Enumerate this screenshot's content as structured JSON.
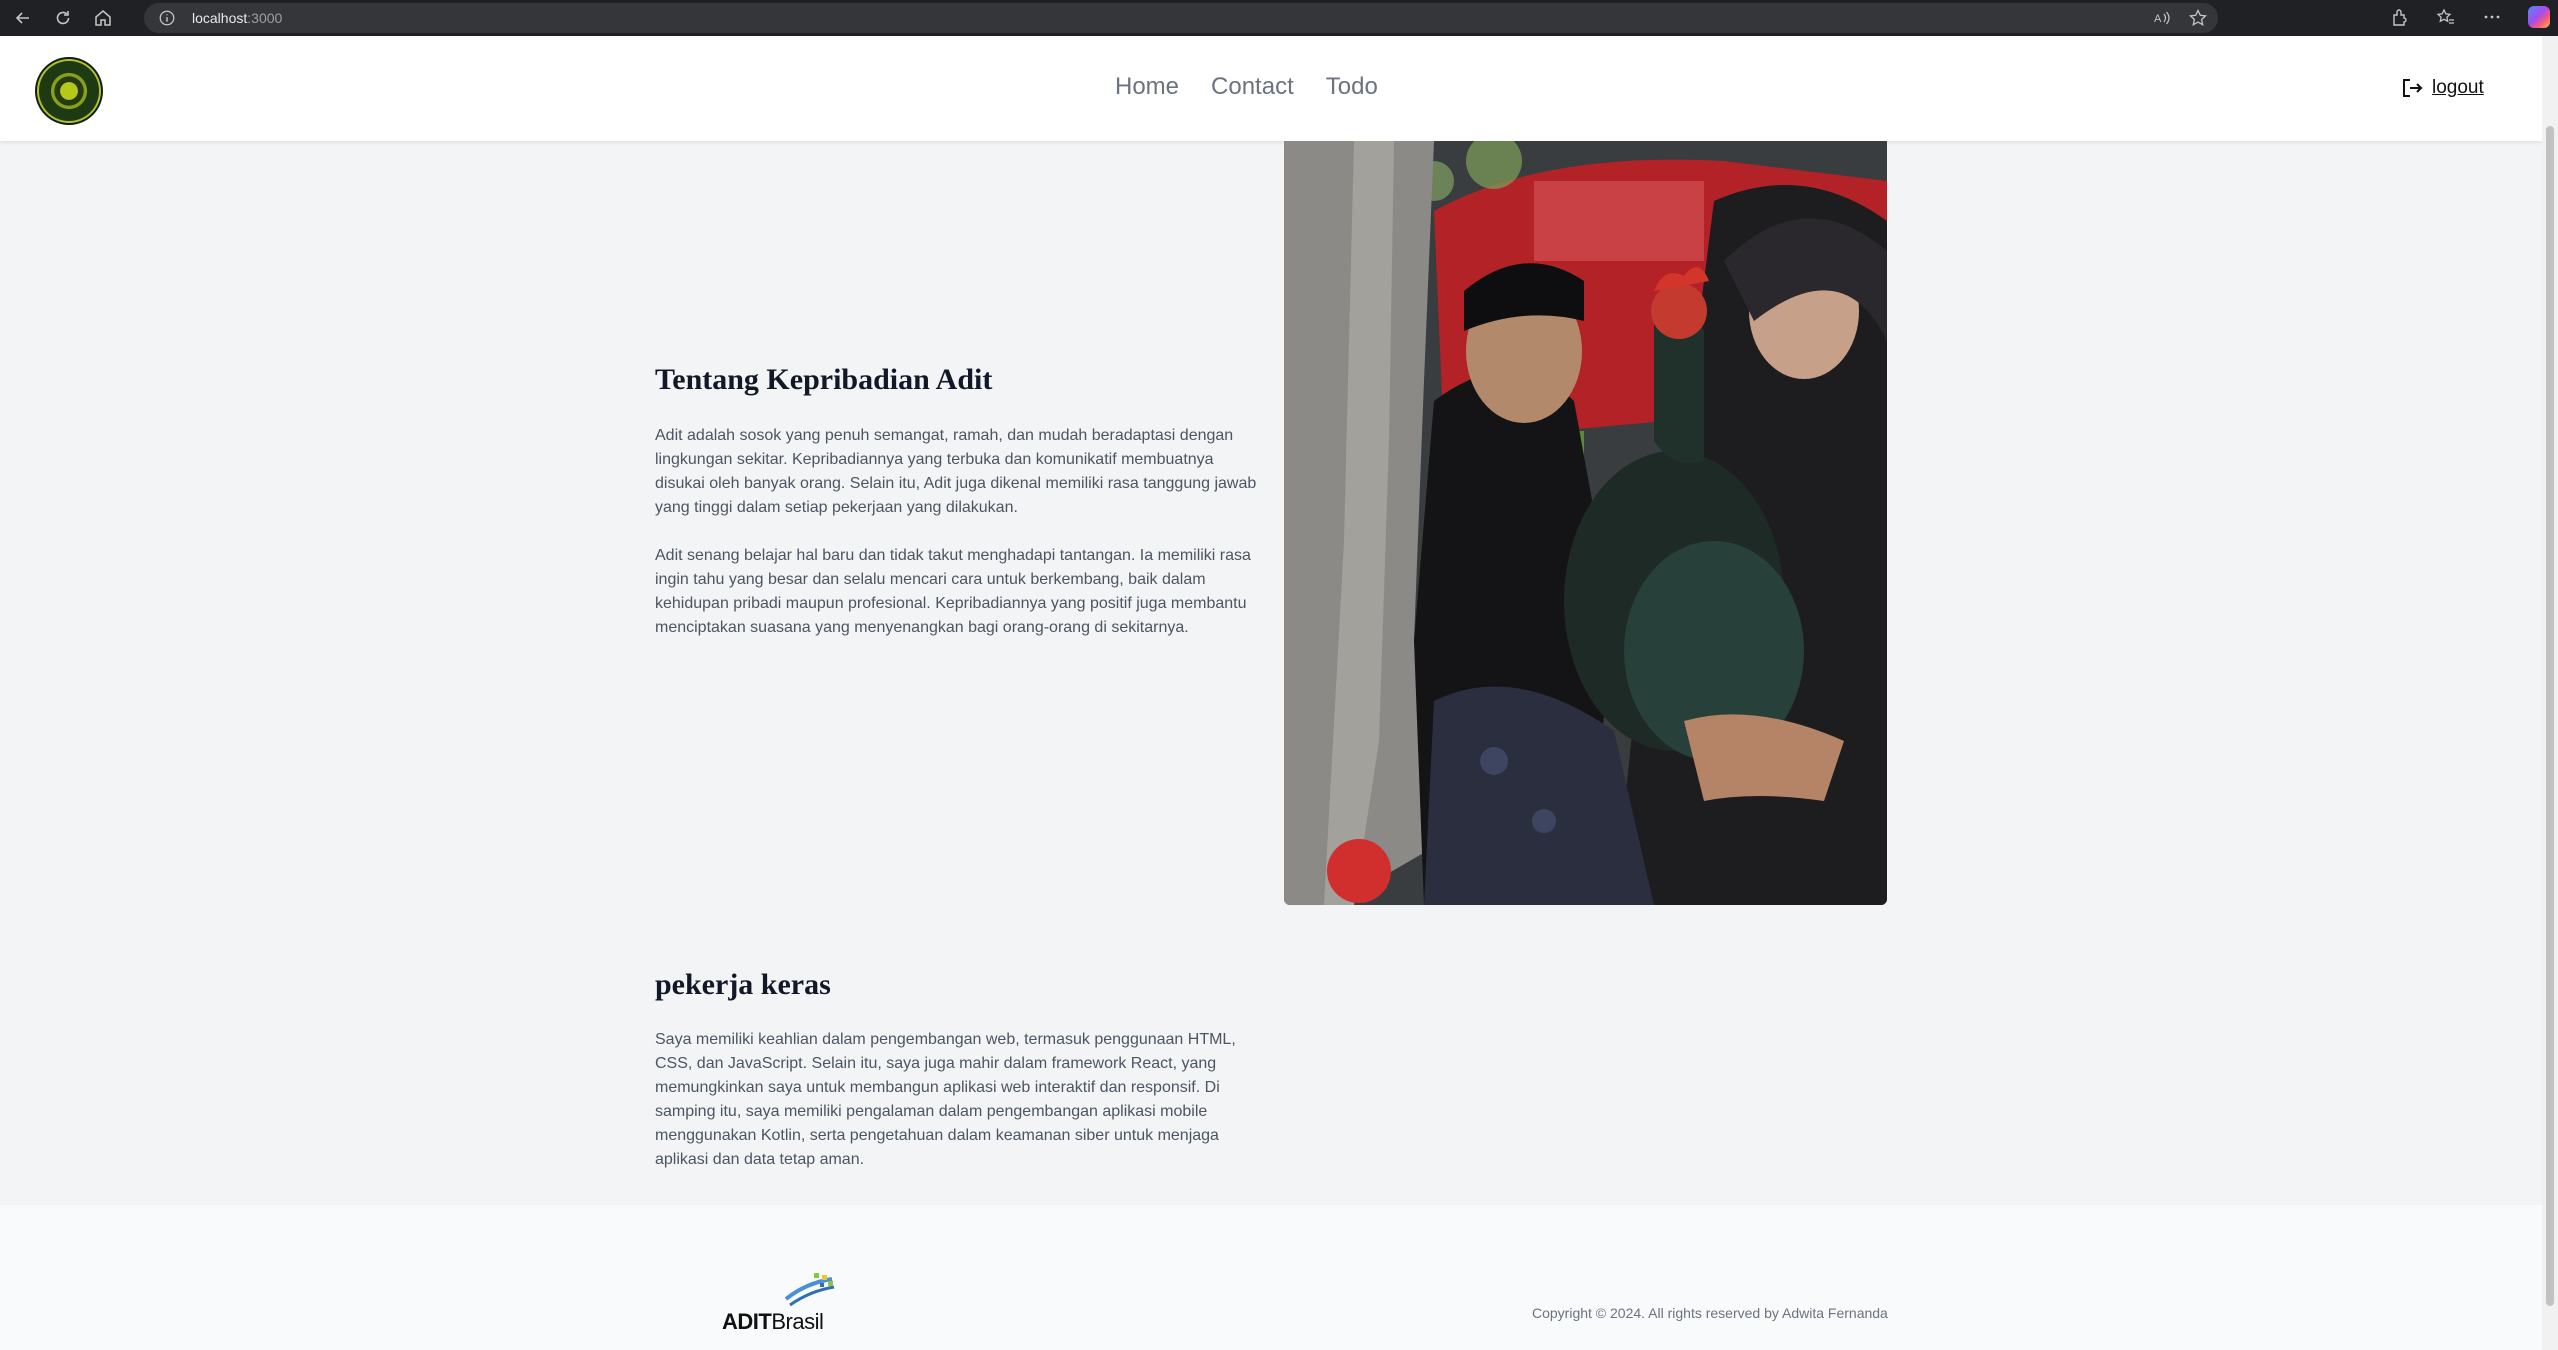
{
  "browser": {
    "url_host": "localhost",
    "url_port": ":3000"
  },
  "nav": {
    "items": [
      {
        "label": "Home"
      },
      {
        "label": "Contact"
      },
      {
        "label": "Todo"
      }
    ],
    "logout_label": "logout"
  },
  "about": {
    "title": "Tentang Kepribadian Adit",
    "paragraphs": [
      "Adit adalah sosok yang penuh semangat, ramah, dan mudah beradaptasi dengan lingkungan sekitar. Kepribadiannya yang terbuka dan komunikatif membuatnya disukai oleh banyak orang. Selain itu, Adit juga dikenal memiliki rasa tanggung jawab yang tinggi dalam setiap pekerjaan yang dilakukan.",
      "Adit senang belajar hal baru dan tidak takut menghadapi tantangan. Ia memiliki rasa ingin tahu yang besar dan selalu mencari cara untuk berkembang, baik dalam kehidupan pribadi maupun profesional. Kepribadiannya yang positif juga membantu menciptakan suasana yang menyenangkan bagi orang-orang di sekitarnya."
    ]
  },
  "work": {
    "title": "pekerja keras",
    "paragraph": "Saya memiliki keahlian dalam pengembangan web, termasuk penggunaan HTML, CSS, dan JavaScript. Selain itu, saya juga mahir dalam framework React, yang memungkinkan saya untuk membangun aplikasi web interaktif dan responsif. Di samping itu, saya memiliki pengalaman dalam pengembangan aplikasi mobile menggunakan Kotlin, serta pengetahuan dalam keamanan siber untuk menjaga aplikasi dan data tetap aman."
  },
  "footer": {
    "brand_bold": "ADIT",
    "brand_rest": "Brasil",
    "copyright": "Copyright © 2024. All rights reserved by Adwita Fernanda"
  },
  "colors": {
    "page_bg": "#f3f4f6",
    "header_bg": "#ffffff",
    "nav_text": "#6b7280",
    "heading": "#111827",
    "body_text": "#4b5563"
  },
  "icons": [
    "back-icon",
    "reload-icon",
    "home-icon",
    "info-icon",
    "read-aloud-icon",
    "favorite-star-icon",
    "extensions-icon",
    "favorites-icon",
    "more-icon",
    "copilot-icon",
    "logout-icon"
  ]
}
